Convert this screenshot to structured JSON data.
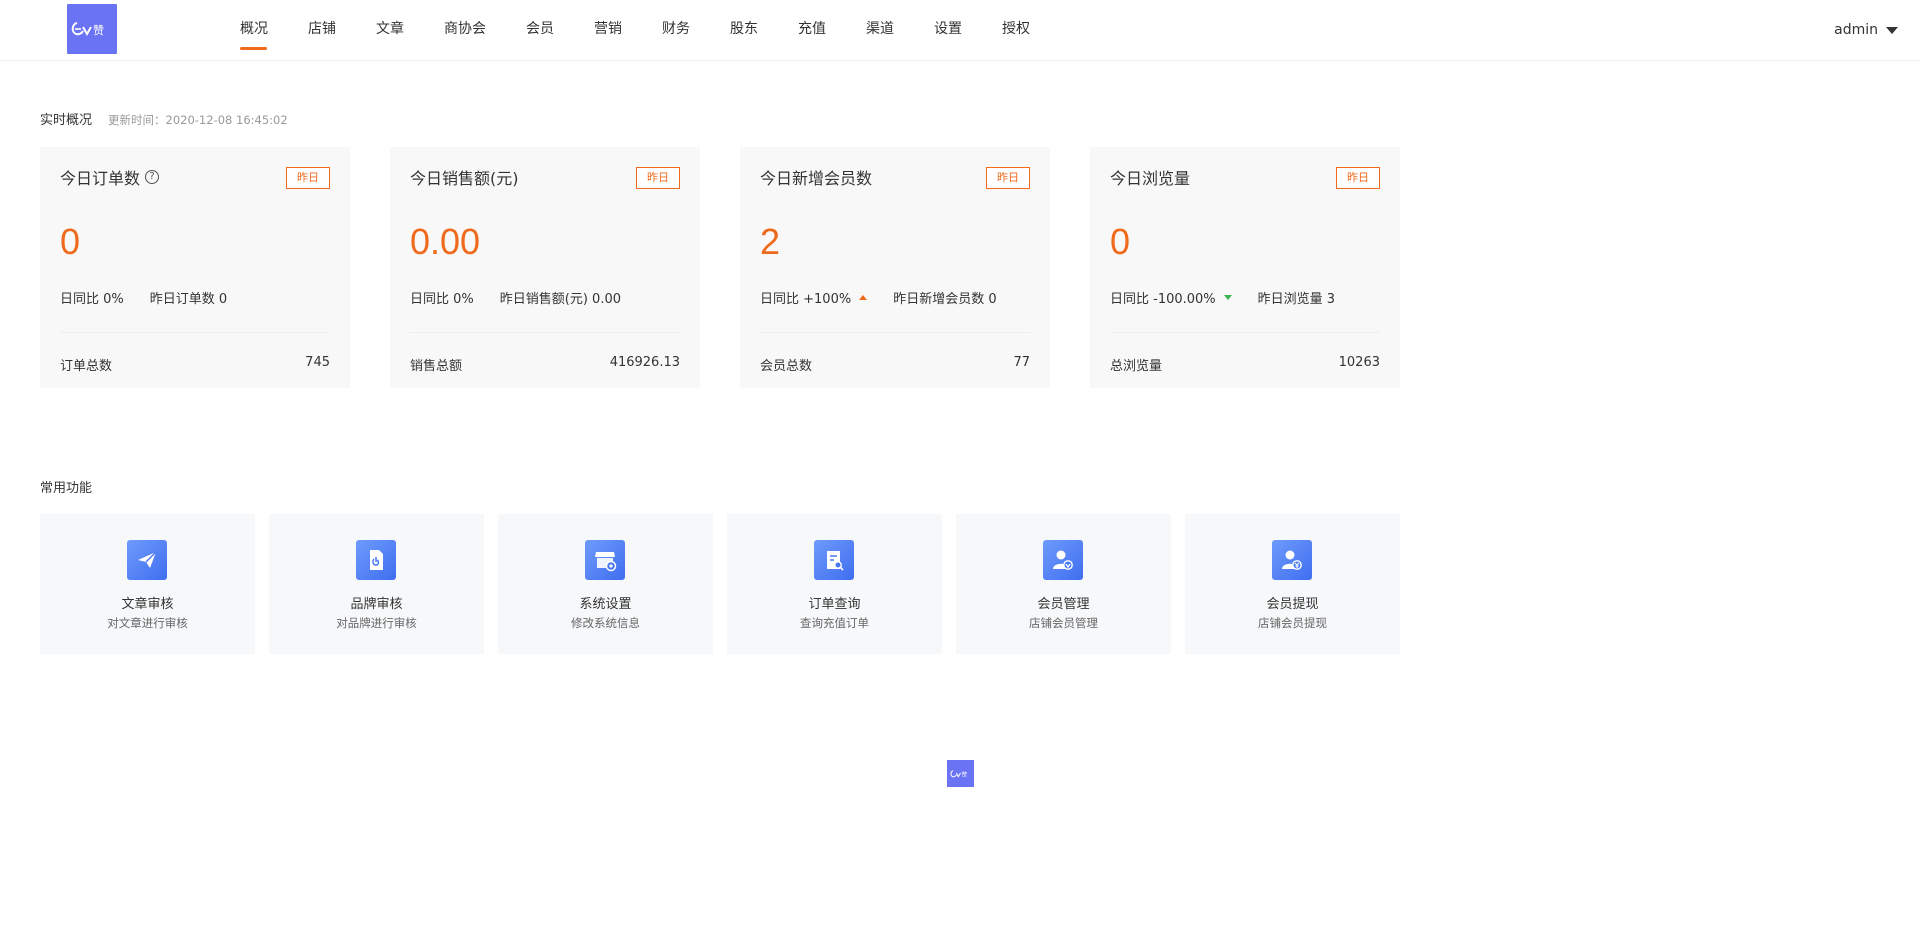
{
  "brand": {
    "logo_text": "ev赞",
    "accent_color": "#f06a1d",
    "logo_bg": "#6a73f3"
  },
  "nav": {
    "items": [
      {
        "label": "概况",
        "active": true
      },
      {
        "label": "店铺",
        "active": false
      },
      {
        "label": "文章",
        "active": false
      },
      {
        "label": "商协会",
        "active": false
      },
      {
        "label": "会员",
        "active": false
      },
      {
        "label": "营销",
        "active": false
      },
      {
        "label": "财务",
        "active": false
      },
      {
        "label": "股东",
        "active": false
      },
      {
        "label": "充值",
        "active": false
      },
      {
        "label": "渠道",
        "active": false
      },
      {
        "label": "设置",
        "active": false
      },
      {
        "label": "授权",
        "active": false
      }
    ]
  },
  "user": {
    "name": "admin"
  },
  "overview": {
    "title": "实时概况",
    "updated": "更新时间：2020-12-08 16:45:02"
  },
  "stats": [
    {
      "title": "今日订单数",
      "has_help": true,
      "yesterday_btn": "昨日",
      "value": "0",
      "ratio": "日同比 0%",
      "trend": "none",
      "yesterday": "昨日订单数 0",
      "total_label": "订单总数",
      "total_value": "745"
    },
    {
      "title": "今日销售额(元)",
      "has_help": false,
      "yesterday_btn": "昨日",
      "value": "0.00",
      "ratio": "日同比 0%",
      "trend": "none",
      "yesterday": "昨日销售额(元) 0.00",
      "total_label": "销售总额",
      "total_value": "416926.13"
    },
    {
      "title": "今日新增会员数",
      "has_help": false,
      "yesterday_btn": "昨日",
      "value": "2",
      "ratio": "日同比 +100%",
      "trend": "up",
      "yesterday": "昨日新增会员数 0",
      "total_label": "会员总数",
      "total_value": "77"
    },
    {
      "title": "今日浏览量",
      "has_help": false,
      "yesterday_btn": "昨日",
      "value": "0",
      "ratio": "日同比 -100.00%",
      "trend": "down",
      "yesterday": "昨日浏览量 3",
      "total_label": "总浏览量",
      "total_value": "10263"
    }
  ],
  "functions": {
    "title": "常用功能",
    "items": [
      {
        "name": "文章审核",
        "desc": "对文章进行审核",
        "icon": "paper-plane-icon"
      },
      {
        "name": "品牌审核",
        "desc": "对品牌进行审核",
        "icon": "document-icon"
      },
      {
        "name": "系统设置",
        "desc": "修改系统信息",
        "icon": "store-settings-icon"
      },
      {
        "name": "订单查询",
        "desc": "查询充值订单",
        "icon": "order-search-icon"
      },
      {
        "name": "会员管理",
        "desc": "店铺会员管理",
        "icon": "member-manage-icon"
      },
      {
        "name": "会员提现",
        "desc": "店铺会员提现",
        "icon": "member-withdraw-icon"
      }
    ]
  }
}
